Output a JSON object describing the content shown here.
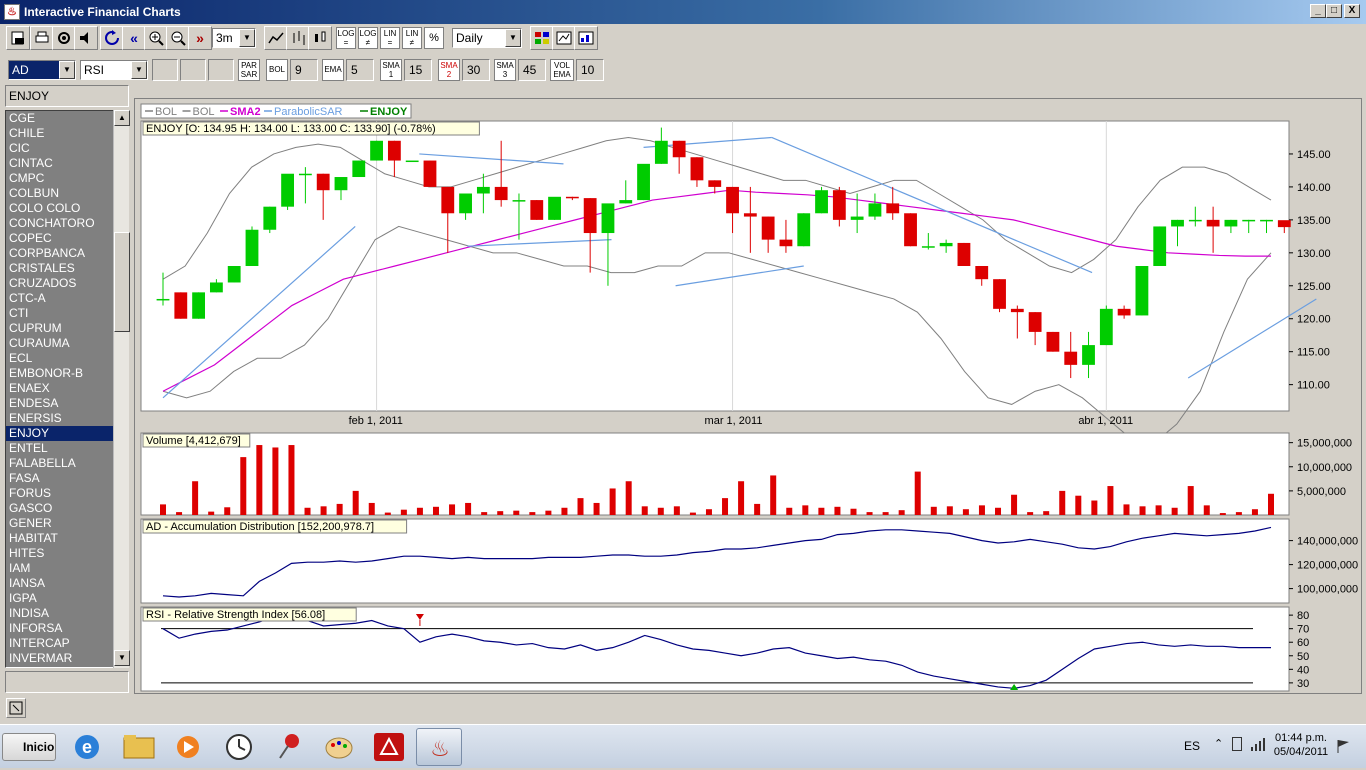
{
  "window": {
    "title": "Interactive Financial Charts",
    "buttons": [
      "_",
      "□",
      "X"
    ]
  },
  "toolbar1": {
    "period_value": "3m",
    "interval_value": "Daily",
    "scale_buttons": [
      "LOG =",
      "LOG ≠",
      "LIN =",
      "LIN ≠",
      "%"
    ]
  },
  "toolbar2": {
    "indicator1": "AD",
    "indicator2": "RSI",
    "par_sar_label": "PAR SAR",
    "bol_label": "BOL",
    "bol_value": "9",
    "ema_label": "EMA",
    "ema_value": "5",
    "sma1_label": "SMA 1",
    "sma1_value": "15",
    "sma2_label": "SMA 2",
    "sma2_value": "30",
    "sma3_label": "SMA 3",
    "sma3_value": "45",
    "volema_label": "VOL EMA",
    "volema_value": "10"
  },
  "symbols": {
    "header": "ENJOY",
    "items": [
      "CGE",
      "CHILE",
      "CIC",
      "CINTAC",
      "CMPC",
      "COLBUN",
      "COLO COLO",
      "CONCHATORO",
      "COPEC",
      "CORPBANCA",
      "CRISTALES",
      "CRUZADOS",
      "CTC-A",
      "CTI",
      "CUPRUM",
      "CURAUMA",
      "ECL",
      "EMBONOR-B",
      "ENAEX",
      "ENDESA",
      "ENERSIS",
      "ENJOY",
      "ENTEL",
      "FALABELLA",
      "FASA",
      "FORUS",
      "GASCO",
      "GENER",
      "HABITAT",
      "HITES",
      "IAM",
      "IANSA",
      "IGPA",
      "INDISA",
      "INFORSA",
      "INTERCAP",
      "INVERMAR"
    ],
    "selected": "ENJOY"
  },
  "legend": [
    {
      "label": "BOL",
      "color": "#808080"
    },
    {
      "label": "BOL",
      "color": "#808080"
    },
    {
      "label": "SMA2",
      "color": "#d000d0"
    },
    {
      "label": "ParabolicSAR",
      "color": "#6a9ee0"
    },
    {
      "label": "ENJOY",
      "color": "#008000"
    }
  ],
  "price_panel": {
    "title": "ENJOY [O: 134.95  H: 134.00  L: 133.00  C: 133.90] (-0.78%)",
    "y_ticks": [
      "145.00",
      "140.00",
      "135.00",
      "130.00",
      "125.00",
      "120.00",
      "115.00",
      "110.00"
    ],
    "x_ticks": [
      "feb 1, 2011",
      "mar 1, 2011",
      "abr 1, 2011"
    ]
  },
  "volume_panel": {
    "title": "Volume [4,412,679]",
    "y_ticks": [
      "15,000,000",
      "10,000,000",
      "5,000,000"
    ]
  },
  "ad_panel": {
    "title": "AD - Accumulation Distribution [152,200,978.7]",
    "y_ticks": [
      "140,000,000",
      "120,000,000",
      "100,000,000"
    ]
  },
  "rsi_panel": {
    "title": "RSI - Relative Strength Index [56.08]",
    "y_ticks": [
      "80",
      "70",
      "60",
      "50",
      "40",
      "30"
    ]
  },
  "colors": {
    "up": "#00cc00",
    "down": "#dd0000",
    "sma2": "#d000d0",
    "sar": "#6a9ee0",
    "bol": "#808080",
    "ad_line": "#000080",
    "rsi_line": "#000080"
  },
  "chart_data": {
    "type": "candlestick",
    "title": "ENJOY [O: 134.95  H: 134.00  L: 133.00  C: 133.90] (-0.78%)",
    "x_ticks": [
      "feb 1, 2011",
      "mar 1, 2011",
      "abr 1, 2011"
    ],
    "ylim": [
      106,
      150
    ],
    "candles": [
      [
        123,
        127,
        122,
        123
      ],
      [
        124,
        124,
        120,
        120
      ],
      [
        120,
        124,
        120,
        124
      ],
      [
        124,
        126,
        124,
        125.5
      ],
      [
        125.5,
        128,
        125.5,
        128
      ],
      [
        128,
        134,
        128,
        133.5
      ],
      [
        133.5,
        137,
        133,
        137
      ],
      [
        137,
        141,
        136.5,
        142
      ],
      [
        142,
        143,
        137.5,
        142
      ],
      [
        142,
        142,
        135,
        139.5
      ],
      [
        139.5,
        141,
        138,
        141.5
      ],
      [
        141.5,
        144,
        141.5,
        144
      ],
      [
        144,
        147,
        144,
        147
      ],
      [
        147,
        147,
        141.5,
        144
      ],
      [
        144,
        144,
        144,
        144
      ],
      [
        144,
        144,
        140,
        140
      ],
      [
        140,
        140,
        130,
        136
      ],
      [
        136,
        139,
        135,
        139
      ],
      [
        139,
        142,
        136,
        140
      ],
      [
        140,
        147,
        137,
        138
      ],
      [
        138,
        139,
        132,
        138
      ],
      [
        138,
        138,
        135,
        135
      ],
      [
        135,
        138,
        135,
        138.5
      ],
      [
        138.5,
        138.5,
        138,
        138.3
      ],
      [
        138.3,
        138.3,
        127,
        133
      ],
      [
        133,
        133,
        125,
        137.5
      ],
      [
        137.5,
        141,
        137.5,
        138
      ],
      [
        138,
        143,
        138,
        143.5
      ],
      [
        143.5,
        149,
        143.5,
        147
      ],
      [
        147,
        147,
        142,
        144.5
      ],
      [
        144.5,
        144.5,
        140,
        141
      ],
      [
        141,
        141,
        139,
        140
      ],
      [
        140,
        140,
        133,
        136
      ],
      [
        136,
        140,
        130,
        135.5
      ],
      [
        135.5,
        135.5,
        130,
        132
      ],
      [
        132,
        135,
        130,
        131
      ],
      [
        131,
        136,
        131,
        136
      ],
      [
        136,
        140,
        136,
        139.5
      ],
      [
        139.5,
        140,
        134,
        135
      ],
      [
        135,
        139,
        133,
        135.5
      ],
      [
        135.5,
        139,
        135,
        137.5
      ],
      [
        137.5,
        140,
        135,
        136
      ],
      [
        136,
        136,
        131,
        131
      ],
      [
        131,
        133,
        130.5,
        131
      ],
      [
        131,
        132,
        130,
        131.5
      ],
      [
        131.5,
        131.5,
        128,
        128
      ],
      [
        128,
        128,
        125,
        126
      ],
      [
        126,
        126,
        121,
        121.5
      ],
      [
        121.5,
        122,
        117,
        121
      ],
      [
        121,
        121,
        116,
        118
      ],
      [
        118,
        118,
        115,
        115
      ],
      [
        115,
        118,
        111,
        113
      ],
      [
        113,
        118,
        111,
        116
      ],
      [
        116,
        122,
        116,
        121.5
      ],
      [
        121.5,
        122,
        120,
        120.5
      ],
      [
        120.5,
        128,
        120.5,
        128
      ],
      [
        128,
        134,
        128,
        134
      ],
      [
        134,
        135,
        131,
        135
      ],
      [
        135,
        137,
        134,
        135
      ],
      [
        135,
        137,
        130,
        134
      ],
      [
        134,
        135,
        133,
        135
      ],
      [
        135,
        135,
        133,
        135
      ],
      [
        135,
        135,
        133,
        135
      ],
      [
        134.95,
        134,
        133,
        133.9
      ]
    ],
    "volume": [
      2.2,
      0.6,
      7.0,
      0.7,
      1.6,
      12.0,
      14.5,
      14.0,
      14.5,
      1.5,
      1.8,
      2.3,
      5.0,
      2.5,
      0.5,
      1.1,
      1.5,
      1.7,
      2.2,
      2.5,
      0.6,
      0.8,
      0.9,
      0.6,
      0.9,
      1.5,
      3.5,
      2.5,
      5.5,
      7.0,
      1.8,
      1.5,
      1.8,
      0.5,
      1.2,
      3.5,
      7.0,
      2.3,
      8.2,
      1.5,
      2.0,
      1.5,
      1.7,
      1.3,
      0.6,
      0.6,
      1.0,
      9.0,
      1.7,
      1.8,
      1.2,
      2.0,
      1.5,
      4.2,
      0.6,
      0.8,
      5.0,
      4.0,
      3.0,
      6.0,
      2.2,
      1.8,
      2.0,
      1.5,
      6.0,
      2.0,
      0.4,
      0.6,
      1.2,
      4.4
    ],
    "ad": [
      94,
      93,
      94,
      96,
      95,
      94,
      106,
      113,
      121,
      122,
      122,
      123,
      122,
      123,
      125,
      127,
      127,
      126,
      125,
      126,
      125,
      125,
      125,
      125,
      126,
      126,
      126,
      127,
      128,
      128,
      127,
      127,
      128,
      130,
      131,
      133,
      133,
      134,
      136,
      138,
      140,
      141,
      145,
      146,
      148,
      149,
      149,
      148,
      147,
      146,
      143,
      140,
      138,
      139,
      141,
      139,
      137,
      134,
      133,
      135,
      139,
      142,
      144,
      146,
      145,
      144,
      145,
      146,
      148,
      151
    ],
    "rsi": [
      70,
      63,
      66,
      68,
      69,
      72,
      75,
      79,
      81,
      76,
      72,
      73,
      74,
      76,
      72,
      70,
      60,
      64,
      66,
      64,
      61,
      60,
      58,
      59,
      56,
      55,
      58,
      54,
      56,
      60,
      65,
      62,
      58,
      55,
      54,
      52,
      50,
      52,
      55,
      56,
      52,
      50,
      48,
      49,
      47,
      46,
      43,
      38,
      35,
      33,
      31,
      29,
      27,
      26,
      28,
      32,
      40,
      48,
      55,
      57,
      59,
      60,
      58,
      57,
      58,
      57,
      57,
      56,
      56,
      56
    ],
    "sma2": [
      109,
      111,
      113,
      116,
      119,
      122,
      124,
      126,
      127,
      128,
      129,
      130,
      131,
      132,
      133,
      134,
      135,
      136,
      137,
      138,
      138.5,
      139,
      139.5,
      139.2,
      139,
      138.8,
      138.5,
      138,
      137.5,
      137,
      136.5,
      136,
      135.5,
      135,
      134,
      133,
      132,
      131,
      130.5,
      130,
      129.8,
      129.6,
      129.5,
      129.5
    ],
    "bol_upper": [
      126,
      128,
      133,
      139,
      143,
      145,
      146,
      146.5,
      146,
      144,
      142,
      141,
      140,
      140,
      141,
      142,
      143,
      144,
      145,
      146,
      147,
      147.5,
      147,
      146,
      145,
      144,
      143,
      142,
      141,
      141,
      140,
      139,
      140,
      141,
      141,
      139,
      137,
      135,
      132,
      130,
      128,
      127,
      129,
      132,
      137,
      141,
      143,
      143,
      142,
      140,
      138
    ],
    "bol_lower": [
      109,
      108,
      109,
      112,
      114,
      114,
      116,
      120,
      126,
      132,
      134,
      133,
      132,
      131,
      130,
      130,
      129,
      128,
      128,
      127,
      127,
      128,
      128,
      130,
      130,
      129,
      128,
      127,
      126,
      125,
      124,
      123,
      121,
      117,
      112,
      108,
      107,
      109,
      110,
      108,
      105,
      102,
      101,
      104,
      109,
      118,
      126,
      130
    ]
  }
}
